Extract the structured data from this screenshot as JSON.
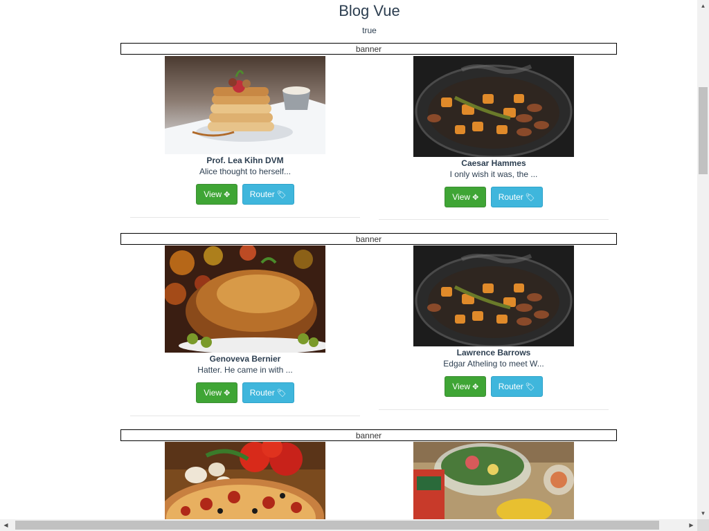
{
  "header": {
    "title": "Blog Vue",
    "status": "true"
  },
  "banner_label": "banner",
  "buttons": {
    "view": "View",
    "router": "Router"
  },
  "posts": [
    {
      "name": "Prof. Lea Kihn DVM",
      "excerpt": "Alice thought to herself...",
      "image": "pancakes"
    },
    {
      "name": "Caesar Hammes",
      "excerpt": "I only wish it was, the ...",
      "image": "roasted-vegetables-skillet"
    },
    {
      "name": "Genoveva Bernier",
      "excerpt": "Hatter. He came in with ...",
      "image": "roast-chicken"
    },
    {
      "name": "Lawrence Barrows",
      "excerpt": "Edgar Atheling to meet W...",
      "image": "roasted-vegetables-skillet"
    },
    {
      "name": "",
      "excerpt": "",
      "image": "pizza"
    },
    {
      "name": "",
      "excerpt": "",
      "image": "salad-bowl"
    }
  ]
}
